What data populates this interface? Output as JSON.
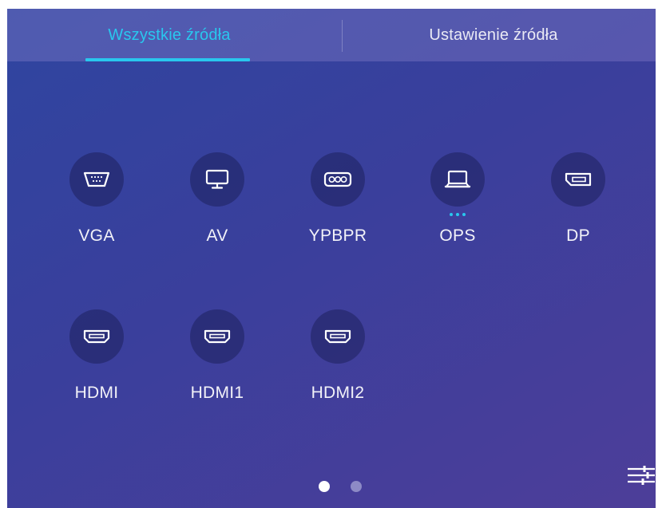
{
  "tabs": [
    {
      "label": "Wszystkie źródła",
      "active": true
    },
    {
      "label": "Ustawienie źródła",
      "active": false
    }
  ],
  "sources": [
    {
      "label": "VGA",
      "icon": "vga-port-icon"
    },
    {
      "label": "AV",
      "icon": "monitor-icon"
    },
    {
      "label": "YPBPR",
      "icon": "component-port-icon"
    },
    {
      "label": "OPS",
      "icon": "laptop-icon",
      "active": true
    },
    {
      "label": "DP",
      "icon": "displayport-icon"
    },
    {
      "label": "HDMI",
      "icon": "hdmi-port-icon"
    },
    {
      "label": "HDMI1",
      "icon": "hdmi-port-icon"
    },
    {
      "label": "HDMI2",
      "icon": "hdmi-port-icon"
    }
  ],
  "pagination": {
    "current_page": 1,
    "total_pages": 2
  },
  "colors": {
    "accent": "#29c7ee",
    "background_start": "#2f45a0",
    "background_end": "#4d3e99"
  },
  "settings_icon": "sliders-icon"
}
